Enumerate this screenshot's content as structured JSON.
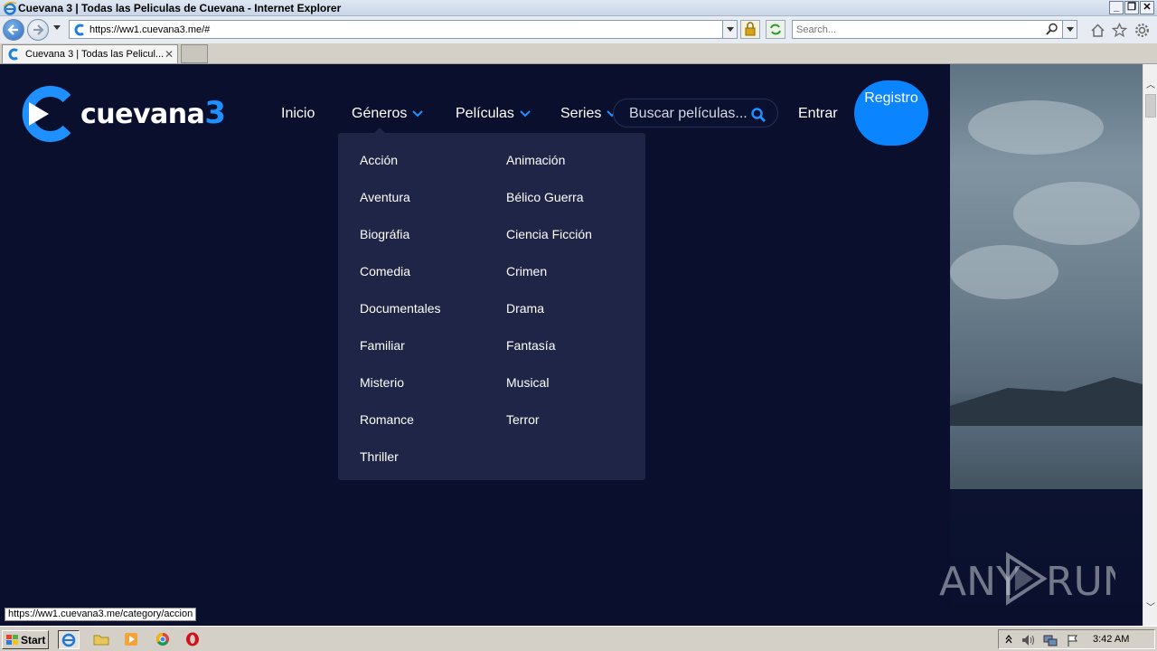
{
  "window": {
    "title": "Cuevana 3 | Todas las Peliculas de Cuevana - Internet Explorer"
  },
  "browser": {
    "address": "https://ww1.cuevana3.me/#",
    "search_placeholder": "Search...",
    "tab_label": "Cuevana 3 | Todas las Pelicul...",
    "status_url": "https://ww1.cuevana3.me/category/accion"
  },
  "site": {
    "logo_text": "cuevana",
    "logo_number": "3",
    "nav": {
      "inicio": "Inicio",
      "generos": "Géneros",
      "peliculas": "Películas",
      "series": "Series",
      "entrar": "Entrar",
      "registro": "Registro"
    },
    "search_placeholder": "Buscar películas...",
    "genres_left": [
      "Acción",
      "Aventura",
      "Biográfia",
      "Comedia",
      "Documentales",
      "Familiar",
      "Misterio",
      "Romance",
      "Thriller"
    ],
    "genres_right": [
      "Animación",
      "Bélico Guerra",
      "Ciencia Ficción",
      "Crimen",
      "Drama",
      "Fantasía",
      "Musical",
      "Terror"
    ],
    "accent_color": "#0a84ff",
    "background_color": "#090f2c",
    "menu_color": "#1e2547"
  },
  "watermark": "ANY RUN",
  "taskbar": {
    "start_label": "Start",
    "clock": "3:42 AM"
  }
}
